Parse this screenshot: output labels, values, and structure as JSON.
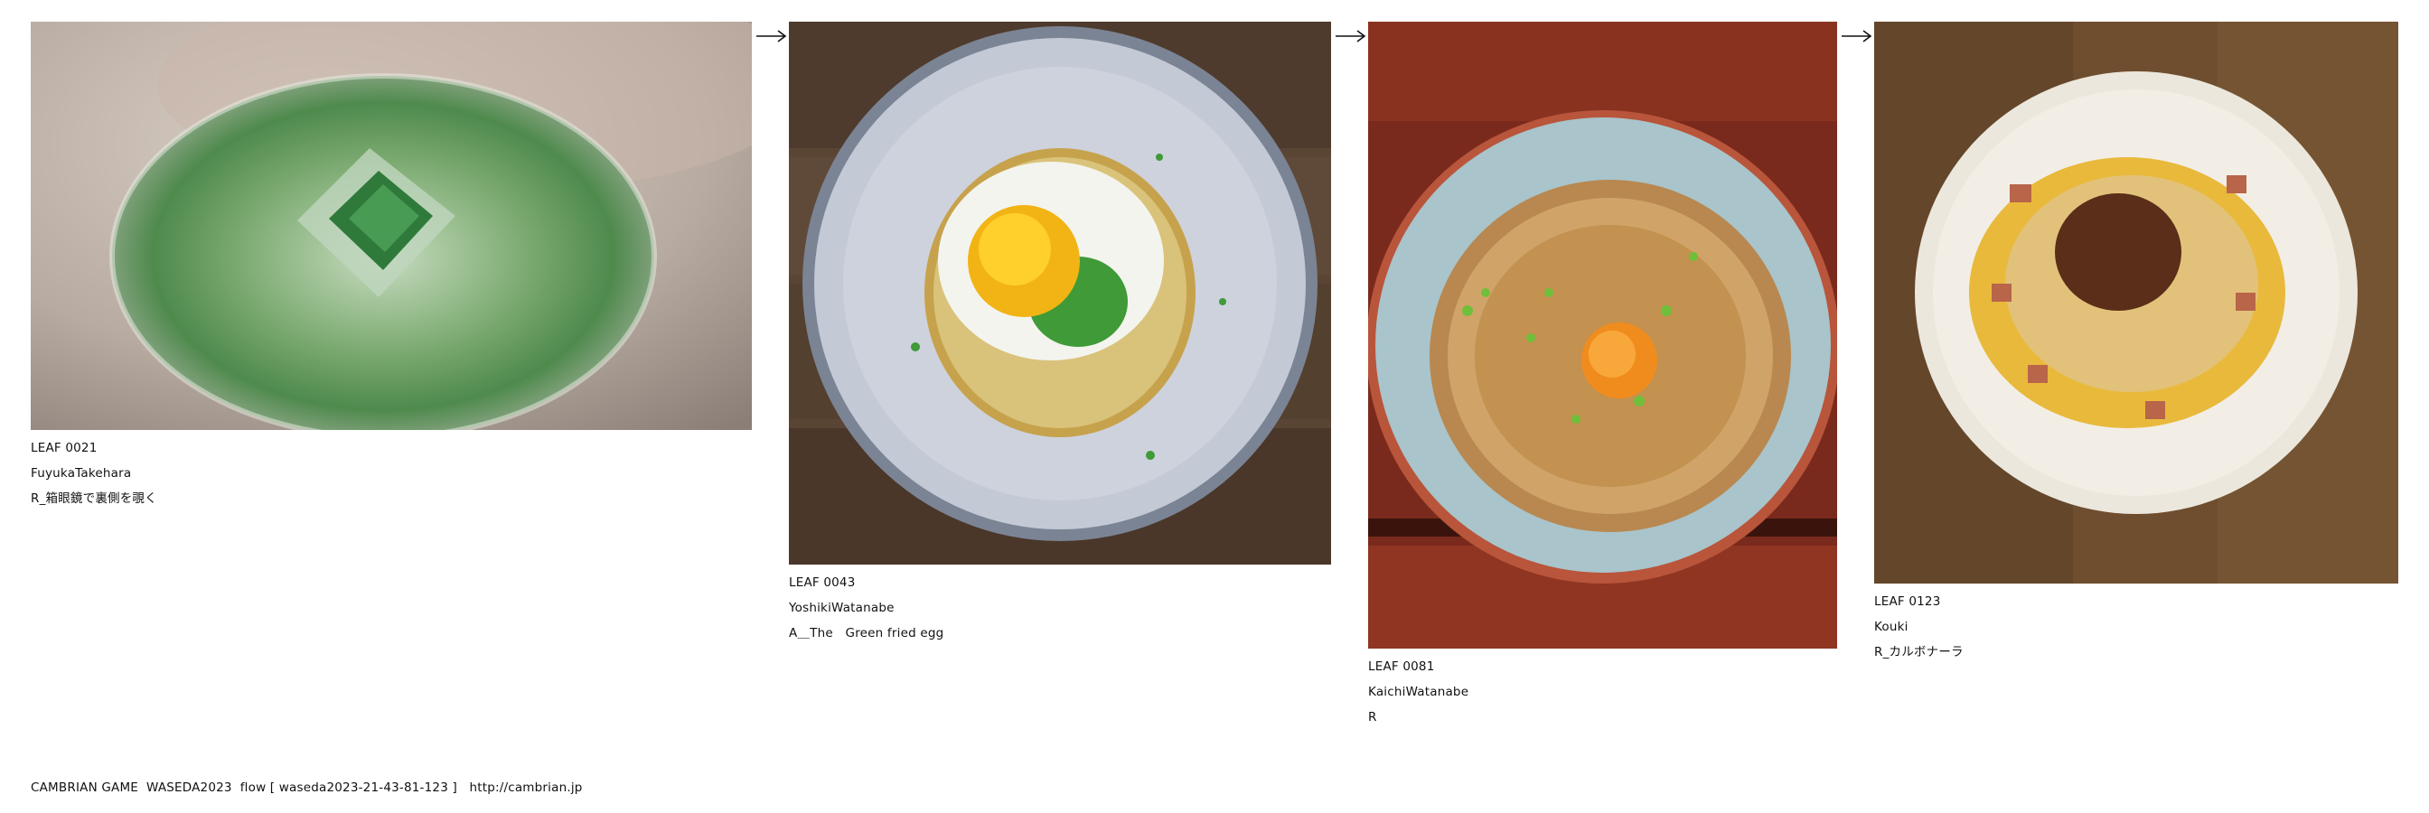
{
  "leaves": [
    {
      "id": "LEAF 0021",
      "author": "FuyukaTakehara",
      "title": "R_箱眼鏡で裏側を覗く",
      "image": "matcha-foam-bowl-photo"
    },
    {
      "id": "LEAF 0043",
      "author": "YoshikiWatanabe",
      "title": "A＿The　Green fried egg",
      "image": "green-fried-egg-photo"
    },
    {
      "id": "LEAF 0081",
      "author": "KaichiWatanabe",
      "title": "R",
      "image": "noodle-bowl-photo"
    },
    {
      "id": "LEAF 0123",
      "author": "Kouki",
      "title": "R_カルボナーラ",
      "image": "carbonara-plate-photo"
    }
  ],
  "flow_arrows": [
    "arrow-right-icon",
    "arrow-right-icon",
    "arrow-right-icon"
  ],
  "footer": {
    "project": "CAMBRIAN GAME  WASEDA2023",
    "flow": "flow [ waseda2023-21-43-81-123 ]",
    "url": "http://cambrian.jp"
  }
}
